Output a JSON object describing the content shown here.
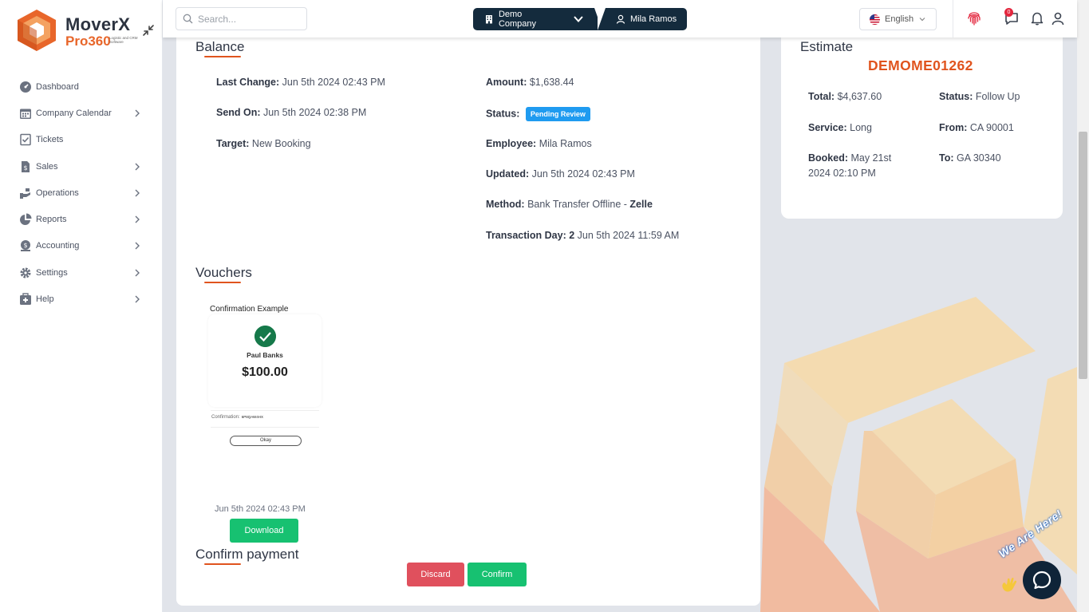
{
  "app": {
    "name": "MoverX",
    "product": "Pro360",
    "tagline": "Logistic and CRM Software"
  },
  "search": {
    "placeholder": "Search..."
  },
  "header": {
    "company": "Demo Company",
    "user": "Mila Ramos",
    "language": "English",
    "chat_badge": "0"
  },
  "sidebar": {
    "items": [
      {
        "label": "Dashboard",
        "icon": "dashboard-icon",
        "has_children": false
      },
      {
        "label": "Company Calendar",
        "icon": "calendar-icon",
        "has_children": true
      },
      {
        "label": "Tickets",
        "icon": "tickets-icon",
        "has_children": false
      },
      {
        "label": "Sales",
        "icon": "sales-icon",
        "has_children": true
      },
      {
        "label": "Operations",
        "icon": "operations-icon",
        "has_children": true
      },
      {
        "label": "Reports",
        "icon": "reports-icon",
        "has_children": true
      },
      {
        "label": "Accounting",
        "icon": "accounting-icon",
        "has_children": true
      },
      {
        "label": "Settings",
        "icon": "settings-icon",
        "has_children": true
      },
      {
        "label": "Help",
        "icon": "help-icon",
        "has_children": true
      }
    ]
  },
  "balance": {
    "title": "Balance",
    "last_change_label": "Last Change:",
    "last_change": "Jun 5th 2024 02:43 PM",
    "send_on_label": "Send On:",
    "send_on": "Jun 5th 2024 02:38 PM",
    "target_label": "Target:",
    "target": "New Booking",
    "amount_label": "Amount:",
    "amount": "$1,638.44",
    "status_label": "Status:",
    "status": "Pending Review",
    "employee_label": "Employee:",
    "employee": "Mila Ramos",
    "updated_label": "Updated:",
    "updated": "Jun 5th 2024 02:43 PM",
    "method_label": "Method:",
    "method": "Bank Transfer Offline",
    "method_sep": "-",
    "method_provider": "Zelle",
    "transaction_label": "Transaction Day:",
    "transaction_day": "2",
    "transaction_date": "Jun 5th 2024 11:59 AM"
  },
  "vouchers": {
    "title": "Vouchers",
    "image": {
      "title": "Confirmation Example",
      "name": "Paul Banks",
      "amount": "$100.00",
      "confirmation_label": "Confirmation:",
      "confirmation_code": "6P8QAW4HX",
      "okay": "Okay"
    },
    "date": "Jun 5th 2024 02:43 PM",
    "download_label": "Download"
  },
  "confirm_payment": {
    "title": "Confirm payment",
    "discard_label": "Discard",
    "confirm_label": "Confirm"
  },
  "estimate": {
    "title": "Estimate",
    "number": "DEMOME01262",
    "total_label": "Total:",
    "total": "$4,637.60",
    "status_label": "Status:",
    "status": "Follow Up",
    "service_label": "Service:",
    "service": "Long",
    "from_label": "From:",
    "from": "CA 90001",
    "booked_label": "Booked:",
    "booked_line1": "May 21st",
    "booked_line2": "2024 02:10 PM",
    "to_label": "To:",
    "to": "GA 30340"
  },
  "chat": {
    "label": "We Are Here!"
  },
  "colors": {
    "accent": "#e0541e",
    "brand_dark": "#142b3d",
    "status_blue": "#1f9bf0",
    "success_green": "#17c171",
    "danger_red": "#e0505d"
  }
}
